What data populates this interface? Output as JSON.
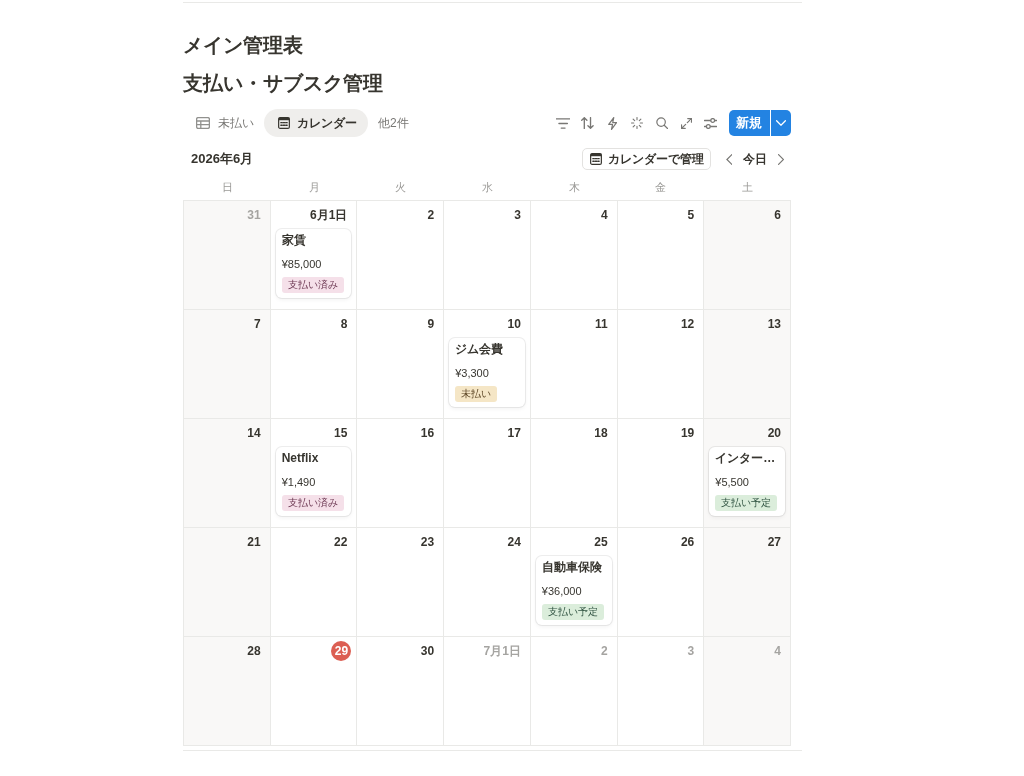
{
  "page": {
    "heading": "メイン管理表",
    "title": "支払い・サブスク管理"
  },
  "views": [
    {
      "label": "未払い",
      "kind": "table",
      "selected": false
    },
    {
      "label": "カレンダー",
      "kind": "calendar",
      "selected": true
    }
  ],
  "more_views": "他2件",
  "new_button": "新規",
  "calendar": {
    "month": "2026年6月",
    "manage_button": "カレンダーで管理",
    "today_button": "今日",
    "weekdays": [
      "日",
      "月",
      "火",
      "水",
      "木",
      "金",
      "土"
    ],
    "weeks": [
      {
        "days": [
          {
            "label": "31",
            "in_month": false,
            "today": false
          },
          {
            "label": "6月1日",
            "in_month": true,
            "today": false,
            "events": [
              {
                "title": "家賃",
                "amount": "¥85,000",
                "status": {
                  "label": "支払い済み",
                  "kind": "paid",
                  "color": "#f5e0e9"
                }
              }
            ]
          },
          {
            "label": "2",
            "in_month": true,
            "today": false
          },
          {
            "label": "3",
            "in_month": true,
            "today": false
          },
          {
            "label": "4",
            "in_month": true,
            "today": false
          },
          {
            "label": "5",
            "in_month": true,
            "today": false
          },
          {
            "label": "6",
            "in_month": true,
            "today": false
          }
        ]
      },
      {
        "days": [
          {
            "label": "7",
            "in_month": true,
            "today": false
          },
          {
            "label": "8",
            "in_month": true,
            "today": false
          },
          {
            "label": "9",
            "in_month": true,
            "today": false
          },
          {
            "label": "10",
            "in_month": true,
            "today": false,
            "events": [
              {
                "title": "ジム会費",
                "amount": "¥3,300",
                "status": {
                  "label": "未払い",
                  "kind": "unpaid",
                  "color": "#f5e6c6"
                }
              }
            ]
          },
          {
            "label": "11",
            "in_month": true,
            "today": false
          },
          {
            "label": "12",
            "in_month": true,
            "today": false
          },
          {
            "label": "13",
            "in_month": true,
            "today": false
          }
        ]
      },
      {
        "days": [
          {
            "label": "14",
            "in_month": true,
            "today": false
          },
          {
            "label": "15",
            "in_month": true,
            "today": false,
            "events": [
              {
                "title": "Netflix",
                "amount": "¥1,490",
                "status": {
                  "label": "支払い済み",
                  "kind": "paid",
                  "color": "#f5e0e9"
                }
              }
            ]
          },
          {
            "label": "16",
            "in_month": true,
            "today": false
          },
          {
            "label": "17",
            "in_month": true,
            "today": false
          },
          {
            "label": "18",
            "in_month": true,
            "today": false
          },
          {
            "label": "19",
            "in_month": true,
            "today": false
          },
          {
            "label": "20",
            "in_month": true,
            "today": false,
            "events": [
              {
                "title": "インター…",
                "amount": "¥5,500",
                "status": {
                  "label": "支払い予定",
                  "kind": "scheduled",
                  "color": "#dbeddb"
                }
              }
            ]
          }
        ]
      },
      {
        "days": [
          {
            "label": "21",
            "in_month": true,
            "today": false
          },
          {
            "label": "22",
            "in_month": true,
            "today": false
          },
          {
            "label": "23",
            "in_month": true,
            "today": false
          },
          {
            "label": "24",
            "in_month": true,
            "today": false
          },
          {
            "label": "25",
            "in_month": true,
            "today": false,
            "events": [
              {
                "title": "自動車保険",
                "amount": "¥36,000",
                "status": {
                  "label": "支払い予定",
                  "kind": "scheduled",
                  "color": "#dbeddb"
                }
              }
            ]
          },
          {
            "label": "26",
            "in_month": true,
            "today": false
          },
          {
            "label": "27",
            "in_month": true,
            "today": false
          }
        ]
      },
      {
        "days": [
          {
            "label": "28",
            "in_month": true,
            "today": false
          },
          {
            "label": "29",
            "in_month": true,
            "today": true
          },
          {
            "label": "30",
            "in_month": true,
            "today": false
          },
          {
            "label": "7月1日",
            "in_month": false,
            "today": false
          },
          {
            "label": "2",
            "in_month": false,
            "today": false
          },
          {
            "label": "3",
            "in_month": false,
            "today": false
          },
          {
            "label": "4",
            "in_month": false,
            "today": false
          }
        ]
      }
    ]
  }
}
